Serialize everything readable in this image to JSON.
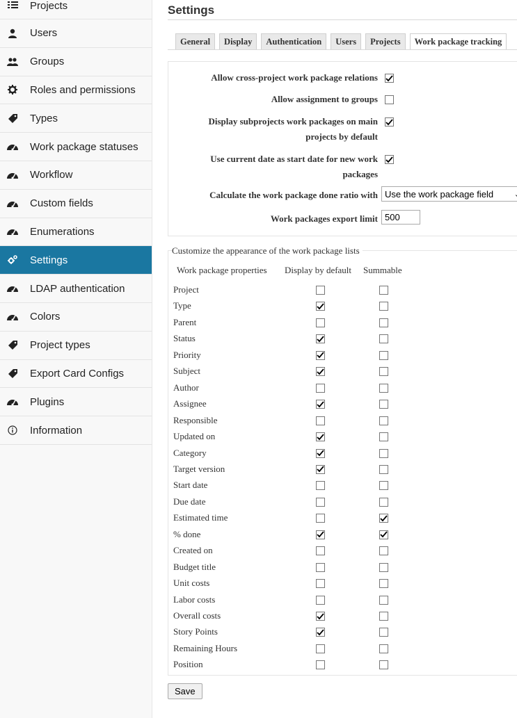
{
  "sidebar": {
    "items": [
      {
        "label": "Projects",
        "icon": "list-icon",
        "active": false
      },
      {
        "label": "Users",
        "icon": "user-icon",
        "active": false
      },
      {
        "label": "Groups",
        "icon": "group-icon",
        "active": false
      },
      {
        "label": "Roles and permissions",
        "icon": "gear-icon",
        "active": false
      },
      {
        "label": "Types",
        "icon": "tag-icon",
        "active": false
      },
      {
        "label": "Work package statuses",
        "icon": "gauge-icon",
        "active": false
      },
      {
        "label": "Workflow",
        "icon": "gauge-icon",
        "active": false
      },
      {
        "label": "Custom fields",
        "icon": "gauge-icon",
        "active": false
      },
      {
        "label": "Enumerations",
        "icon": "gauge-icon",
        "active": false
      },
      {
        "label": "Settings",
        "icon": "gears-icon",
        "active": true
      },
      {
        "label": "LDAP authentication",
        "icon": "gauge-icon",
        "active": false
      },
      {
        "label": "Colors",
        "icon": "gauge-icon",
        "active": false
      },
      {
        "label": "Project types",
        "icon": "tag-icon",
        "active": false
      },
      {
        "label": "Export Card Configs",
        "icon": "tag-icon",
        "active": false
      },
      {
        "label": "Plugins",
        "icon": "gauge-icon",
        "active": false
      },
      {
        "label": "Information",
        "icon": "info-icon",
        "active": false
      }
    ]
  },
  "page": {
    "title": "Settings",
    "save_label": "Save"
  },
  "tabs": [
    {
      "label": "General",
      "selected": false
    },
    {
      "label": "Display",
      "selected": false
    },
    {
      "label": "Authentication",
      "selected": false
    },
    {
      "label": "Users",
      "selected": false
    },
    {
      "label": "Projects",
      "selected": false
    },
    {
      "label": "Work package tracking",
      "selected": true
    }
  ],
  "settings": {
    "cross_project_label": "Allow cross-project work package relations",
    "cross_project": true,
    "assign_groups_label": "Allow assignment to groups",
    "assign_groups": false,
    "subprojects_label_1": "Display subprojects work packages on main",
    "subprojects_label_2": "projects by default",
    "subprojects": true,
    "start_date_label_1": "Use current date as start date for new work",
    "start_date_label_2": "packages",
    "start_date": true,
    "done_ratio_label": "Calculate the work package done ratio with",
    "done_ratio_value": "Use the work package field",
    "export_limit_label": "Work packages export limit",
    "export_limit_value": "500"
  },
  "appearance": {
    "legend": "Customize the appearance of the work package lists",
    "headers": {
      "property": "Work package properties",
      "display": "Display by default",
      "summable": "Summable"
    },
    "rows": [
      {
        "name": "Project",
        "display": false,
        "summable": false
      },
      {
        "name": "Type",
        "display": true,
        "summable": false
      },
      {
        "name": "Parent",
        "display": false,
        "summable": false
      },
      {
        "name": "Status",
        "display": true,
        "summable": false
      },
      {
        "name": "Priority",
        "display": true,
        "summable": false
      },
      {
        "name": "Subject",
        "display": true,
        "summable": false
      },
      {
        "name": "Author",
        "display": false,
        "summable": false
      },
      {
        "name": "Assignee",
        "display": true,
        "summable": false
      },
      {
        "name": "Responsible",
        "display": false,
        "summable": false
      },
      {
        "name": "Updated on",
        "display": true,
        "summable": false
      },
      {
        "name": "Category",
        "display": true,
        "summable": false
      },
      {
        "name": "Target version",
        "display": true,
        "summable": false
      },
      {
        "name": "Start date",
        "display": false,
        "summable": false
      },
      {
        "name": "Due date",
        "display": false,
        "summable": false
      },
      {
        "name": "Estimated time",
        "display": false,
        "summable": true
      },
      {
        "name": "% done",
        "display": true,
        "summable": true
      },
      {
        "name": "Created on",
        "display": false,
        "summable": false
      },
      {
        "name": "Budget title",
        "display": false,
        "summable": false
      },
      {
        "name": "Unit costs",
        "display": false,
        "summable": false
      },
      {
        "name": "Labor costs",
        "display": false,
        "summable": false
      },
      {
        "name": "Overall costs",
        "display": true,
        "summable": false
      },
      {
        "name": "Story Points",
        "display": true,
        "summable": false
      },
      {
        "name": "Remaining Hours",
        "display": false,
        "summable": false
      },
      {
        "name": "Position",
        "display": false,
        "summable": false
      }
    ]
  },
  "colors": {
    "sidebar_active": "#1a77a1",
    "sidebar_bg": "#f8f8f8"
  }
}
